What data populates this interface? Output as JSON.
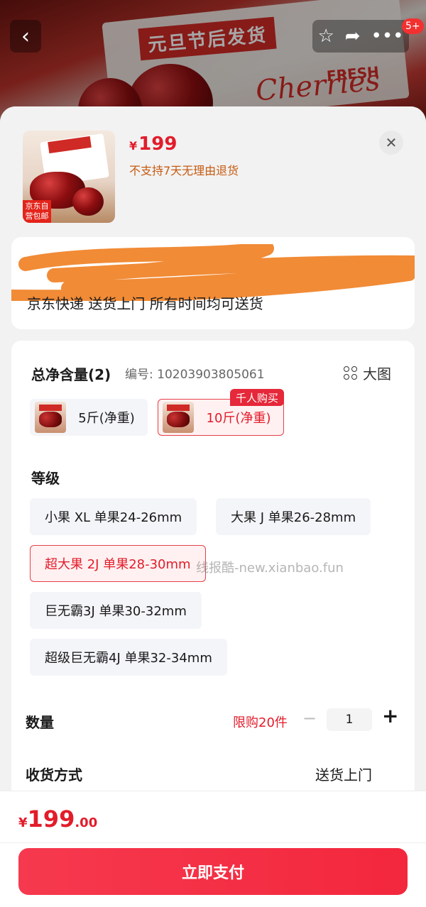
{
  "hero": {
    "banner_text": "元旦节后发货",
    "fresh_text": "FRESH",
    "script_text": "Cherries",
    "cart_badge": "5+"
  },
  "product": {
    "currency": "¥",
    "price": "199",
    "return_policy": "不支持7天无理由退货",
    "thumb_tag": "京东自营包邮"
  },
  "address": {
    "delivery_info": "京东快递 送货上门 所有时间均可送货"
  },
  "spec": {
    "net_weight_title": "总净含量(2)",
    "sku_number": "编号: 10203903805061",
    "big_image_label": "大图",
    "weight_options": [
      {
        "label": "5斤(净重)",
        "selected": false
      },
      {
        "label": "10斤(净重)",
        "selected": true
      }
    ],
    "hot_tag": "千人购买",
    "grade_title": "等级",
    "grade_options": [
      {
        "label": "小果 XL 单果24-26mm",
        "selected": false
      },
      {
        "label": "大果 J 单果26-28mm",
        "selected": false
      },
      {
        "label": "超大果 2J 单果28-30mm",
        "selected": true
      },
      {
        "label": "巨无霸3J 单果30-32mm",
        "selected": false
      },
      {
        "label": "超级巨无霸4J 单果32-34mm",
        "selected": false
      }
    ],
    "watermark": "线报酷-new.xianbao.fun"
  },
  "quantity": {
    "title": "数量",
    "limit": "限购20件",
    "minus": "−",
    "value": "1",
    "plus": "+"
  },
  "shipping": {
    "title": "收货方式",
    "value": "送货上门"
  },
  "footer": {
    "currency": "¥",
    "price_int": "199",
    "price_dec": ".00",
    "pay_button": "立即支付"
  },
  "colors": {
    "accent": "#e21c2a",
    "pay_button": "#f3273d",
    "selected_bg": "#fff1f1",
    "return_policy": "#c65a10"
  }
}
